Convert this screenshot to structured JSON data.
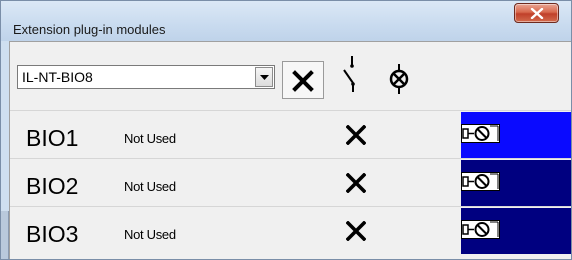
{
  "window": {
    "title": "Extension plug-in modules"
  },
  "toolbar": {
    "module_select_value": "IL-NT-BIO8",
    "icons": [
      "close-x-icon",
      "switch-contact-icon",
      "lamp-indicator-icon"
    ]
  },
  "rows": [
    {
      "name": "BIO1",
      "status": "Not Used",
      "swatch_color": "#0a0aff"
    },
    {
      "name": "BIO2",
      "status": "Not Used",
      "swatch_color": "#000080"
    },
    {
      "name": "BIO3",
      "status": "Not Used",
      "swatch_color": "#000080"
    }
  ]
}
